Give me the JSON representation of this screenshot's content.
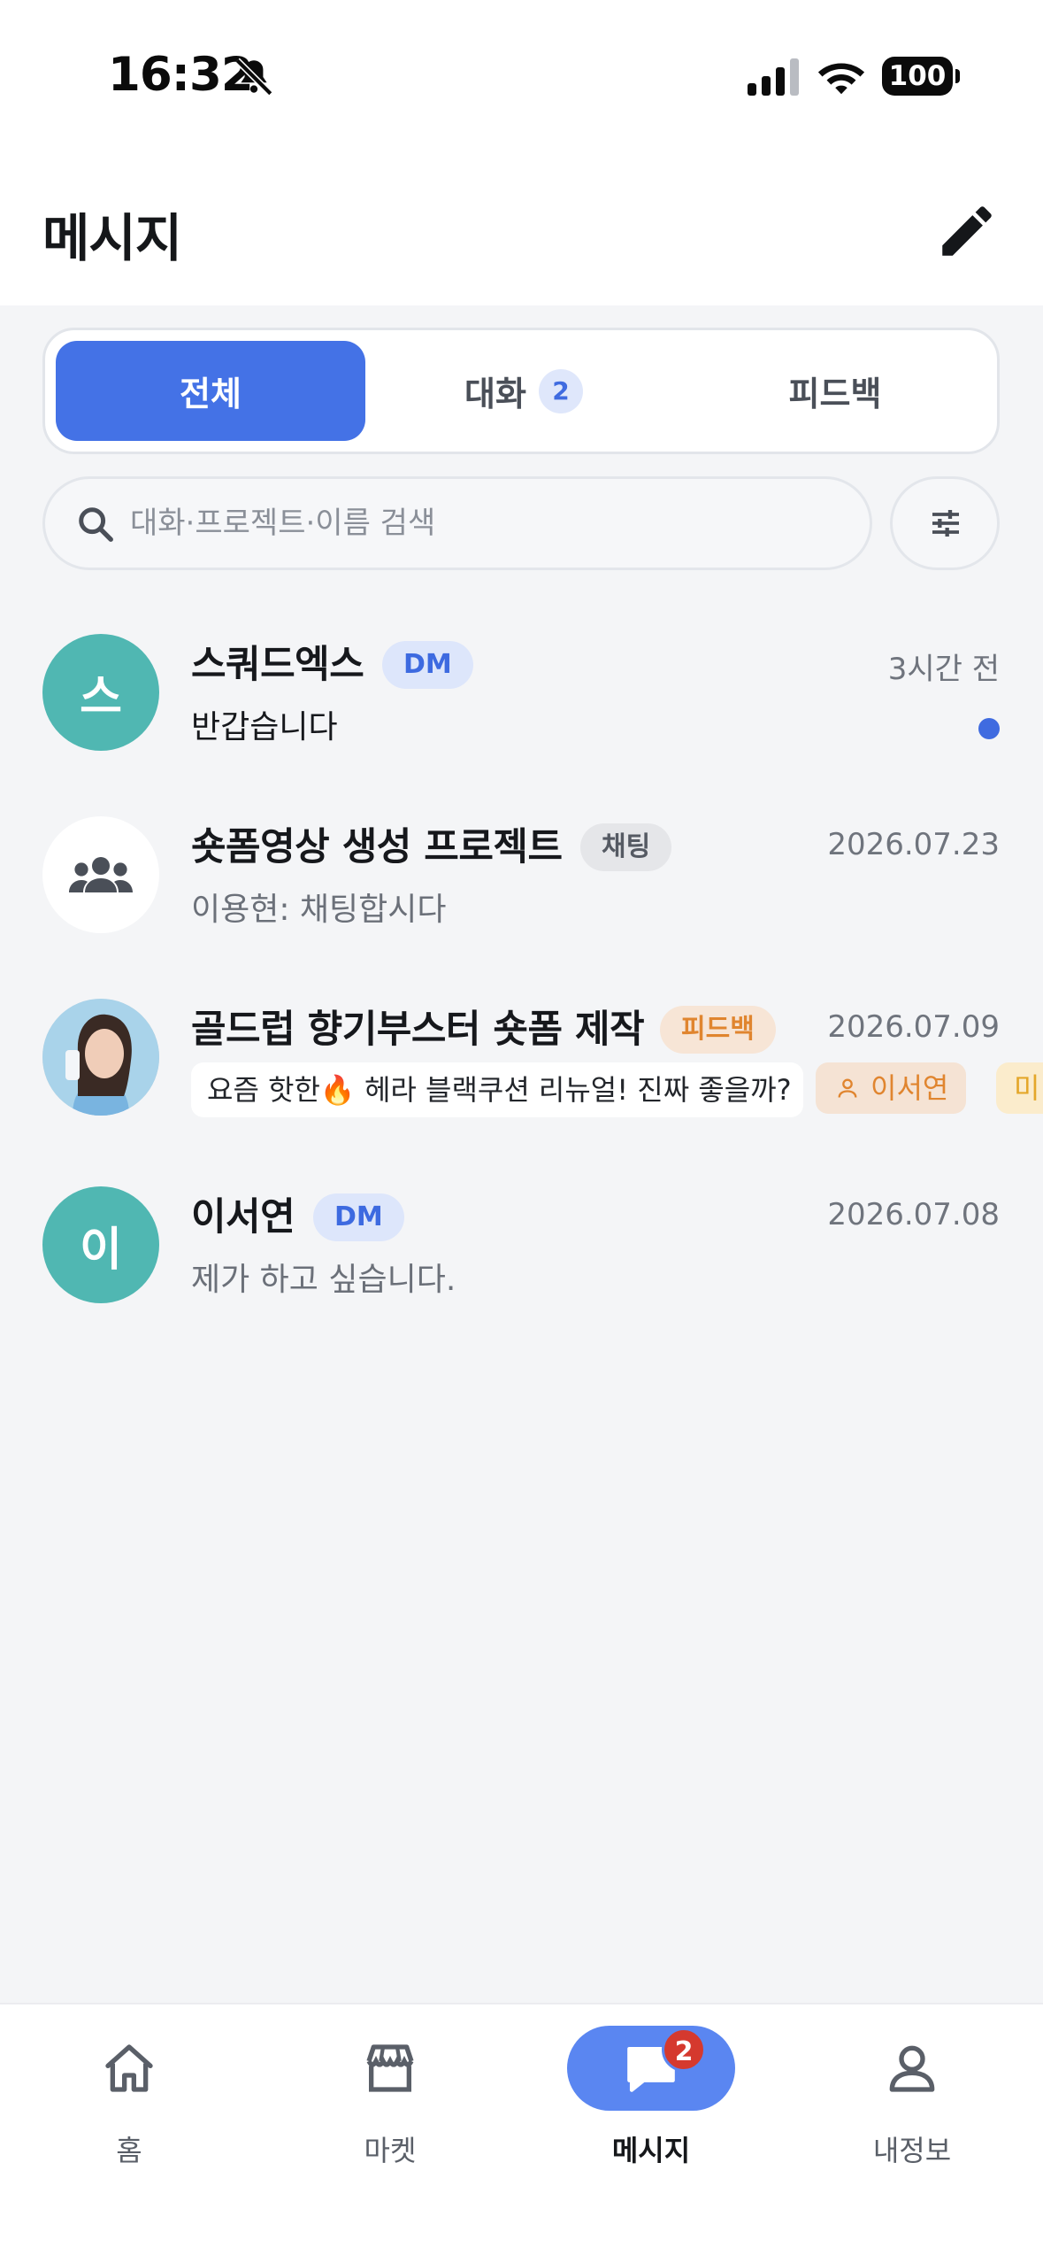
{
  "status_bar": {
    "time": "16:32",
    "battery": "100"
  },
  "header": {
    "title": "메시지"
  },
  "tabs": [
    {
      "label": "전체",
      "active": true
    },
    {
      "label": "대화",
      "badge": "2",
      "active": false
    },
    {
      "label": "피드백",
      "active": false
    }
  ],
  "search": {
    "placeholder": "대화·프로젝트·이름 검색",
    "value": ""
  },
  "conversations": [
    {
      "avatar_text": "스",
      "name": "스쿼드엑스",
      "tag": "DM",
      "time": "3시간 전",
      "preview": "반갑습니다",
      "unread": true
    },
    {
      "avatar_icon": "group-icon",
      "name": "숏폼영상 생성 프로젝트",
      "tag": "채팅",
      "time": "2026.07.23",
      "preview": "이용현: 채팅합시다"
    },
    {
      "avatar_icon": "profile-photo",
      "name": "골드럽 향기부스터 숏폼 제작",
      "tag": "피드백",
      "time": "2026.07.09",
      "preview": "요즘 핫한🔥 헤라 블랙쿠션 리뉴얼! 진짜 좋을까?",
      "person": "이서연",
      "extra": "미"
    },
    {
      "avatar_text": "이",
      "name": "이서연",
      "tag": "DM",
      "time": "2026.07.08",
      "preview": "제가 하고 싶습니다."
    }
  ],
  "bottom_nav": {
    "items": [
      {
        "label": "홈",
        "icon": "home-icon"
      },
      {
        "label": "마켓",
        "icon": "store-icon"
      },
      {
        "label": "메시지",
        "icon": "chat-icon",
        "badge": "2",
        "active": true
      },
      {
        "label": "내정보",
        "icon": "person-icon"
      }
    ]
  },
  "colors": {
    "accent": "#4472e6",
    "teal_avatar": "#50b7b2",
    "feedback_orange": "#e0852f",
    "badge_red": "#d5392e"
  }
}
